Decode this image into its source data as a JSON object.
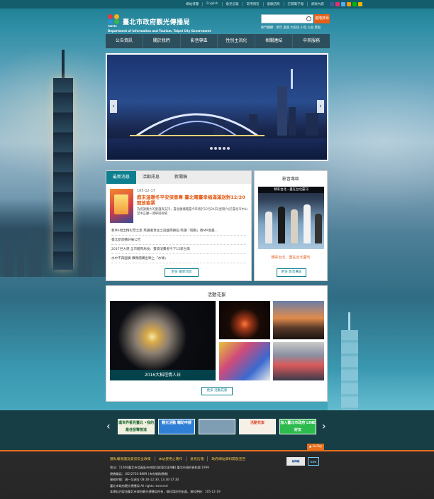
{
  "top_links": [
    "網站導覽",
    "English",
    "意見信箱",
    "常用問答",
    "意願訪問",
    "訂閱電子報",
    "網頁內容"
  ],
  "social_colors": [
    "#3b5998",
    "#e1306c",
    "#55acee",
    "#ff9900",
    "#00b900",
    "#f4b400"
  ],
  "logo": {
    "text": "臺北市政府觀光傳播局",
    "mark_label": "TAIPEI",
    "sub": "Department of Information and Tourism, Taipei City Government"
  },
  "search": {
    "placeholder": "",
    "button_label": "進階搜尋",
    "hotwords": "熱門關鍵：新年 旅遊 大稻埕 小吃 公益 景點"
  },
  "nav": [
    "公告資訊",
    "關於我們",
    "影音專區",
    "性別主流化",
    "相關連結",
    "中英服務"
  ],
  "slider": {
    "prev": "‹",
    "next": "›",
    "dots": 5
  },
  "news": {
    "tabs": [
      "最新消息",
      "活動訊息",
      "新聞稿"
    ],
    "featured": {
      "date": "105-12-17",
      "title": "鹿末溫暖冬平安保意專 臺北電臺幸福滿滿送對12/20開放索票",
      "desc": "為感謝廣大的愛護與支持，臺北廣播電臺今年將於12月24日(星期六)於臺北市中山堂中正廳一連舉辦兩場"
    },
    "list": [
      "教MA唱出精彩票之旅 熊讚邀世主之說國際舞蹈 熊讚「閱兩」教MA唱最...",
      "臺北新遊購好展公告",
      "2017世大運 全市體育局長：臺灣消費者今下15新台灣",
      "水中不再國廣 攝像團購出樂上「水球」"
    ],
    "more": "更多 最新消息"
  },
  "video": {
    "title": "影音專區",
    "overlay": "精彩台北・盡在台北臺刊",
    "caption": "精彩台北．盡在台北臺刊",
    "more": "更多 影音專區"
  },
  "gallery": {
    "title": "活動花絮",
    "big_caption": "2016大稻埕情人日",
    "more": "更多 活動花絮"
  },
  "banners": [
    {
      "label": "讓世界看見臺北 •我的最佳發聲管道",
      "bg": "#f3efe0",
      "fg": "#1a6a2f"
    },
    {
      "label": "觀光活動 輔助申請",
      "bg": "#2f7fd6",
      "fg": "#ffffff"
    },
    {
      "label": "",
      "bg": "#7f9db3",
      "fg": "#ffffff"
    },
    {
      "label": "活動花絮",
      "bg": "#f6f0e6",
      "fg": "#d94a2a"
    },
    {
      "label": "加入臺北市政府 LINE 好友",
      "bg": "#2dbb4e",
      "fg": "#ffffff"
    }
  ],
  "footer": {
    "gotop": "▲ GoTop",
    "links": [
      "隱私權保護及資訊安全政策",
      "本站使用之著作",
      "意見信箱",
      "政府網站資料開放宣告"
    ],
    "info": [
      "地址：11008臺北市信義區市府路1號(東北區9樓) 臺北市政府資料處 1999",
      "總機電話：(02)2720-8889 (市府服務總機)",
      "服務時間：週一至週五 08:30-12:30, 13:30-17:30",
      "臺北市政府觀光傳播局 All rights reserved",
      "本網站內容由臺北市政府觀光傳播局所有，翻印請註明出處。資料更新：105-12-19"
    ],
    "badges": [
      "無障礙",
      "GOV"
    ]
  }
}
